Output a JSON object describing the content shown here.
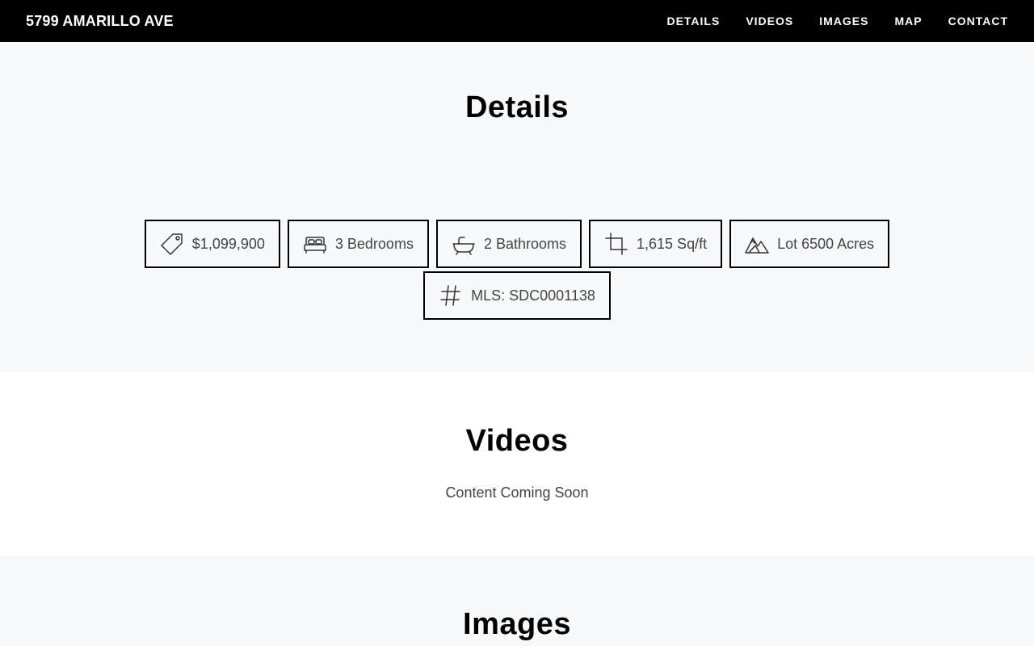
{
  "header": {
    "brand": "5799 AMARILLO AVE",
    "nav": [
      "DETAILS",
      "VIDEOS",
      "IMAGES",
      "MAP",
      "CONTACT"
    ]
  },
  "details": {
    "title": "Details",
    "stats": [
      {
        "icon": "price-tag-icon",
        "label": "$1,099,900"
      },
      {
        "icon": "bed-icon",
        "label": "3 Bedrooms"
      },
      {
        "icon": "bathtub-icon",
        "label": "2 Bathrooms"
      },
      {
        "icon": "crop-icon",
        "label": "1,615 Sq/ft"
      },
      {
        "icon": "mountains-icon",
        "label": "Lot 6500 Acres"
      },
      {
        "icon": "hash-icon",
        "label": "MLS: SDC0001138"
      }
    ]
  },
  "videos": {
    "title": "Videos",
    "message": "Content Coming Soon"
  },
  "images": {
    "title": "Images"
  },
  "colors": {
    "topbar": "#000000",
    "section_alt": "#f8f9fa",
    "border": "#000000",
    "muted_text": "#444444"
  }
}
